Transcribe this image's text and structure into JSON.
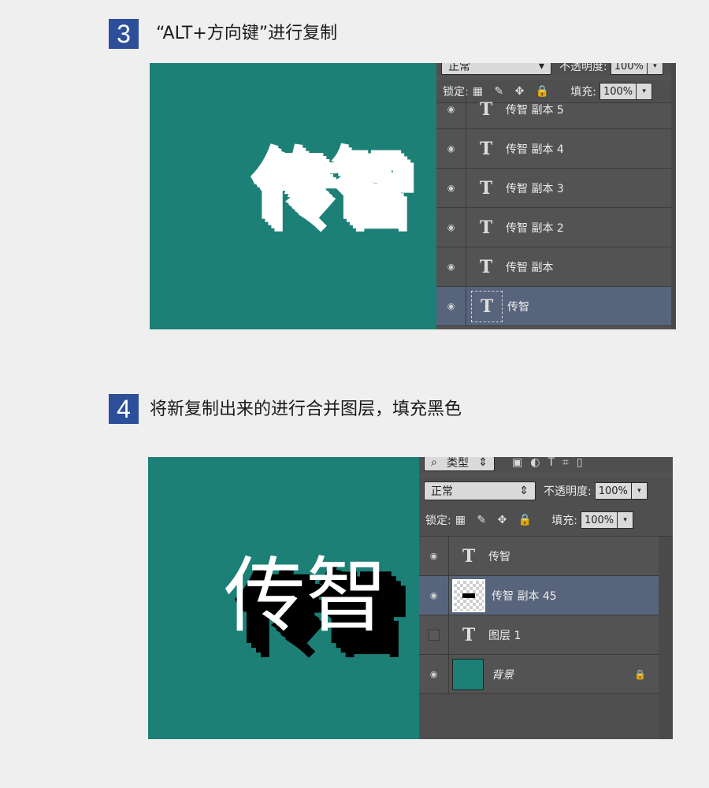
{
  "step3": {
    "number": "3",
    "title": "“ALT+方向键”进行复制",
    "canvas_text": "传智",
    "panel": {
      "blend_mode": "正常",
      "opacity_label": "不透明度:",
      "opacity_value": "100%",
      "lock_label": "锁定:",
      "fill_label": "填充:",
      "fill_value": "100%",
      "layers": [
        {
          "name": "传智 副本 5",
          "icon": "text-layer-icon"
        },
        {
          "name": "传智 副本 4",
          "icon": "text-layer-icon"
        },
        {
          "name": "传智 副本 3",
          "icon": "text-layer-icon"
        },
        {
          "name": "传智 副本 2",
          "icon": "text-layer-icon"
        },
        {
          "name": "传智 副本",
          "icon": "text-layer-icon"
        },
        {
          "name": "传智",
          "icon": "text-layer-icon",
          "selected": true
        }
      ]
    }
  },
  "step4": {
    "number": "4",
    "title": "将新复制出来的进行合并图层，填充黑色",
    "canvas_text": "传智",
    "panel": {
      "filter_label": "类型",
      "blend_mode": "正常",
      "opacity_label": "不透明度:",
      "opacity_value": "100%",
      "lock_label": "锁定:",
      "fill_label": "填充:",
      "fill_value": "100%",
      "layers": [
        {
          "name": "传智",
          "icon": "text-layer-icon"
        },
        {
          "name": "传智 副本 45",
          "icon": "raster-thumbnail",
          "selected": true
        },
        {
          "name": "图层 1",
          "icon": "text-layer-icon",
          "visible": false
        },
        {
          "name": "背景",
          "icon": "teal-thumbnail",
          "locked": true
        }
      ]
    }
  },
  "colors": {
    "accent_badge": "#2d4f9a",
    "canvas_teal": "#1c8077",
    "panel_bg": "#535353",
    "selected_layer": "#58647b"
  },
  "glyphs": {
    "T": "T",
    "eye": "◉",
    "dropdown": "▾",
    "updown": "⇕",
    "lock": "🔒"
  }
}
